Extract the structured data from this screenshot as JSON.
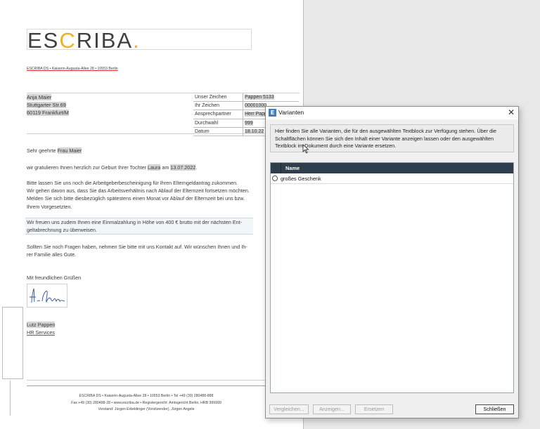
{
  "document": {
    "logo": {
      "part1": "ES",
      "c": "C",
      "part2": "RIBA",
      "dot": "."
    },
    "sender_line": "ESCRIBA DS • Kaiserin-Augusta-Allee 28 • 10553 Berlin",
    "recipient": [
      "Anja Maier",
      "Stuttgarter Str.69",
      "60119 Frankfurt/M"
    ],
    "meta": [
      {
        "key": "Unser Zeichen",
        "value": "Pappen 5133"
      },
      {
        "key": "Ihr Zeichen",
        "value": "00001000"
      },
      {
        "key": "Ansprechpartner",
        "value": "Herr Pappen"
      },
      {
        "key": "Durchwahl",
        "value": "999"
      },
      {
        "key": "Datum",
        "value": "18.10.22"
      }
    ],
    "salutation_prefix": "Sehr geehrte ",
    "salutation_name": "Frau Maier",
    "congrats_prefix": "wir gratulieren Ihnen herzlich zur Geburt Ihrer Tochter ",
    "congrats_name": "Laura",
    "congrats_mid": " am ",
    "congrats_date": "13.07.2022",
    "congrats_suffix": ".",
    "para1": [
      "Bitte lassen Sie uns noch die Arbeitgeberbescheinigung für Ihren Elterngeldantrag zukommen.",
      "Wir gehen davon aus, dass Sie das Arbeitsverhältnis nach Ablauf der Elternzeit fortsetzen möchten.",
      "Melden Sie sich bitte diesbezüglich spätestens einen Monat vor Ablauf der Elternzeit bei uns bzw.",
      "Ihrem Vorgesetzten."
    ],
    "para_boxed": [
      "Wir freuen uns zudem Ihnen eine Einmalzahlung in Höhe von 400 € brutto mit der nächsten Ent-",
      "geltabrechnung zu überweisen."
    ],
    "para3": [
      "Sollten Sie noch Fragen haben, nehmen Sie bitte mit uns Kontakt auf. Wir wünschen Ihnen und Ih-",
      "rer Familie alles Gute."
    ],
    "closing": "Mit freundlichen Grüßen",
    "signer_name": "Lutz Pappen",
    "signer_dept": "HR Services",
    "footer": [
      "ESCRIBA DS • Kaiserin-Augusta-Allee 28 • 10553 Berlin • Tel +49 (30) 280488-888",
      "Fax +49 (30) 280488-28 • www.escriba.de • Registergericht: Amtsgericht Berlin, HRB 999999",
      "Vorstand: Jürgen Erbeldinger (Vorsitzender), Jürgen Angele"
    ]
  },
  "dialog": {
    "title": "Varianten",
    "app_icon_letter": "E",
    "close_glyph": "✕",
    "info": "Hier finden Sie alle Varianten, die für den ausgewählten Textblock zur Verfügung stehen. Über die Schaltflächen können Sie sich den Inhalt einer Variante anzeigen lassen oder den ausgewählten Textblock im Dokument durch eine Variante ersetzen.",
    "column_header": "Name",
    "rows": [
      "großes Geschenk"
    ],
    "buttons": {
      "compare": "Vergleichen...",
      "show": "Anzeigen...",
      "replace": "Ersetzen",
      "close": "Schließen"
    }
  },
  "colors": {
    "accent_yellow": "#f2b01e",
    "header_dark": "#2e3e4c",
    "footer_green": "#8cc04b"
  }
}
